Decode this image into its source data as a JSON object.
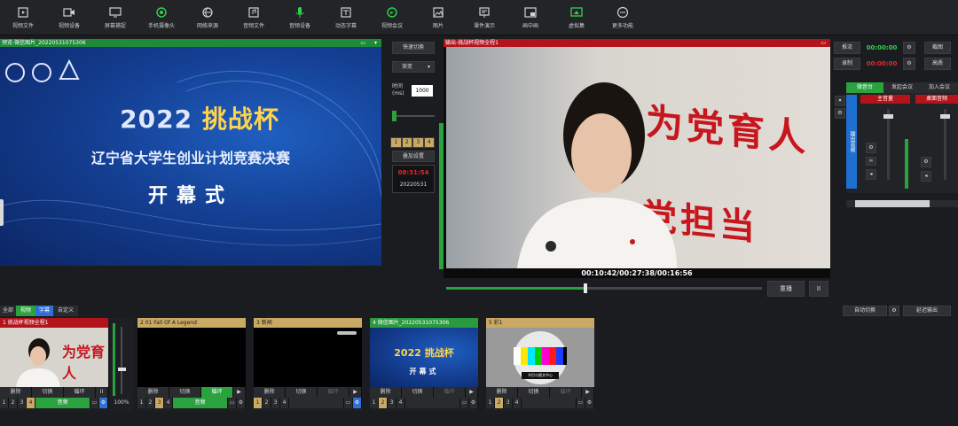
{
  "toolbar": {
    "items": [
      {
        "label": "视频文件",
        "icon": "video-file-icon"
      },
      {
        "label": "视频设备",
        "icon": "video-device-icon"
      },
      {
        "label": "屏幕捕捉",
        "icon": "screen-capture-icon"
      },
      {
        "label": "手机摄像头",
        "icon": "phone-camera-icon"
      },
      {
        "label": "网络来源",
        "icon": "network-source-icon"
      },
      {
        "label": "音频文件",
        "icon": "audio-file-icon"
      },
      {
        "label": "音频设备",
        "icon": "microphone-icon"
      },
      {
        "label": "动态字幕",
        "icon": "caption-icon"
      },
      {
        "label": "视频会议",
        "icon": "video-meeting-icon"
      },
      {
        "label": "图片",
        "icon": "image-icon"
      },
      {
        "label": "课件演示",
        "icon": "presentation-icon"
      },
      {
        "label": "画中画",
        "icon": "pip-icon"
      },
      {
        "label": "虚拟集",
        "icon": "virtual-set-icon"
      },
      {
        "label": "更多功能",
        "icon": "more-icon"
      }
    ]
  },
  "preview": {
    "title": "预览-微信图片_20220531075306",
    "slide": {
      "year": "2022 ",
      "highlight": "挑战杯",
      "line2": "辽宁省大学生创业计划竞赛决赛",
      "line3": "开幕式"
    }
  },
  "transition": {
    "quick_label": "快速切换",
    "effect": "渐变",
    "time_label": "时间(ms)",
    "time_value": "1000",
    "slots": [
      "1",
      "2",
      "3",
      "4"
    ],
    "overlay_label": "叠加设置",
    "clock": "08:31:54",
    "date": "20220531"
  },
  "output": {
    "title": "输出-挑战杯视频全程1",
    "slogan1": "为党育人",
    "slogan2": "党担当",
    "timecode": "00:10:42/00:27:38/00:16:56",
    "replay_label": "重播",
    "pause_label": "II",
    "progress": 0.44
  },
  "right": {
    "stream_label": "推流",
    "stream_time": "00:00:00",
    "record_label": "录制",
    "record_time": "00:00:00",
    "screenshot_label": "截图",
    "hd_label": "高质",
    "tabs": [
      "微音台",
      "发起会议",
      "加入会议"
    ],
    "output_label": "输出音频",
    "channels": [
      "主音量",
      "桌面音频"
    ]
  },
  "filters": {
    "tabs": [
      "全部",
      "视频",
      "字幕",
      "自定义"
    ],
    "auto_switch": "自动切换",
    "delay_output": "延迟输出"
  },
  "sources": [
    {
      "title": "1 挑战杯视频全程1",
      "buttons": [
        "删除",
        "切换",
        "循环",
        "II"
      ],
      "selected": "4",
      "mode": "音频"
    },
    {
      "title": "2 01 Fall Of A Legend",
      "buttons": [
        "删除",
        "切换",
        "循环",
        "▶"
      ],
      "selected": "3",
      "mode": "音频"
    },
    {
      "title": "3 新闻",
      "buttons": [
        "删除",
        "切换",
        "循环",
        "▶"
      ],
      "selected": "1",
      "mode": ""
    },
    {
      "title": "4 微信图片_20220531075306",
      "buttons": [
        "删除",
        "切换",
        "循环",
        "▶"
      ],
      "selected": "2",
      "mode": ""
    },
    {
      "title": "5 彩1",
      "buttons": [
        "删除",
        "切换",
        "循环",
        "▶"
      ],
      "selected": "2",
      "mode": ""
    }
  ],
  "src4_thumb": {
    "line1": "2022 挑战杯",
    "line2": "开幕式"
  },
  "src5_thumb": {
    "label": "节目与图文中心"
  },
  "volume_percent": "100%",
  "colors": {
    "preview_header": "#1f8a3a",
    "output_header": "#b3141b",
    "accent_green": "#2aa33f",
    "source_header": "#c9a964"
  }
}
